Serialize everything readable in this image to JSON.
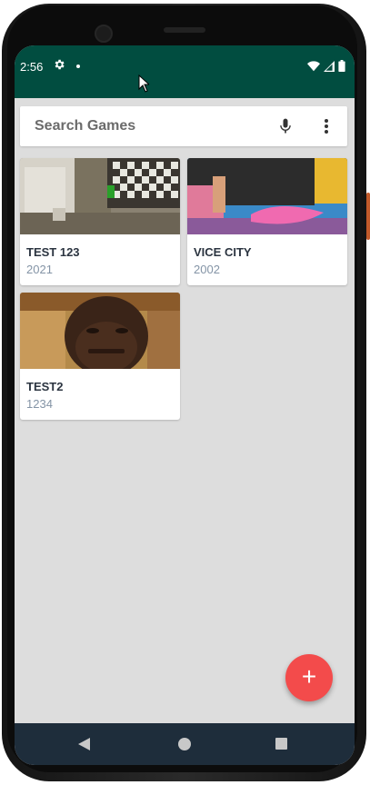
{
  "status_bar": {
    "time": "2:56",
    "settings_icon": "gear-icon",
    "notification_icon": "dot-icon",
    "wifi_icon": "wifi-icon",
    "signal_icon": "signal-icon",
    "battery_icon": "battery-icon"
  },
  "search": {
    "placeholder": "Search Games",
    "mic_icon": "mic-icon",
    "menu_icon": "more-vert-icon"
  },
  "games": [
    {
      "title": "TEST 123",
      "year": "2021"
    },
    {
      "title": "VICE CITY",
      "year": "2002"
    },
    {
      "title": "TEST2",
      "year": "1234"
    }
  ],
  "fab": {
    "label": "+",
    "icon": "add-icon"
  },
  "nav": {
    "back_icon": "back-triangle-icon",
    "home_icon": "home-circle-icon",
    "recents_icon": "recents-square-icon"
  },
  "colors": {
    "status_bar": "#014d40",
    "background": "#dddddd",
    "fab": "#f34b4b",
    "nav_bar": "#1e2d3b"
  }
}
